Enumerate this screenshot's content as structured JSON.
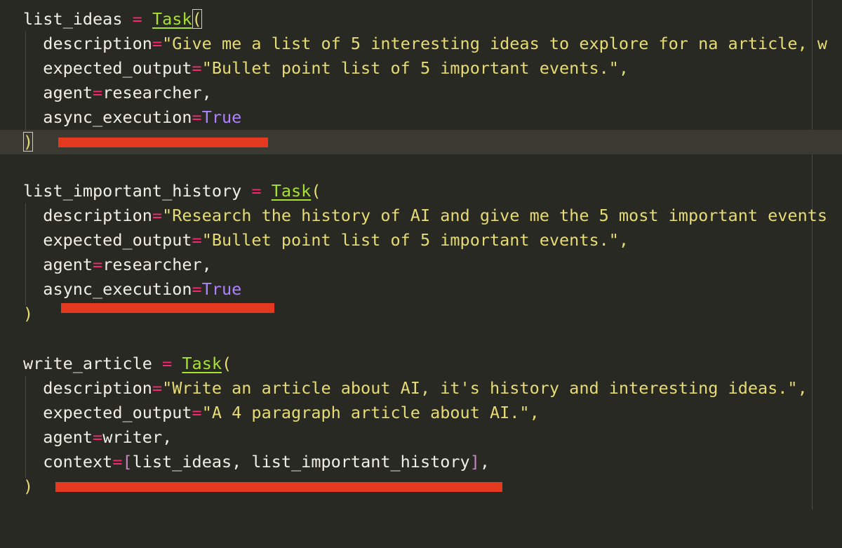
{
  "editor": {
    "blocks": [
      {
        "var": "list_ideas",
        "eq": "=",
        "cls": "Task",
        "open": "(",
        "desc_key": "description",
        "desc_val": "\"Give me a list of 5 interesting ideas to explore for na article, w",
        "exp_key": "expected_output",
        "exp_val": "\"Bullet point list of 5 important events.\",",
        "agent_key": "agent",
        "agent_val": "researcher,",
        "last_key": "async_execution",
        "last_val": "True",
        "close": ")"
      },
      {
        "var": "list_important_history",
        "eq": "=",
        "cls": "Task",
        "open": "(",
        "desc_key": "description",
        "desc_val": "\"Research the history of AI and give me the 5 most important events",
        "exp_key": "expected_output",
        "exp_val": "\"Bullet point list of 5 important events.\",",
        "agent_key": "agent",
        "agent_val": "researcher,",
        "last_key": "async_execution",
        "last_val": "True",
        "close": ")"
      },
      {
        "var": "write_article",
        "eq": "=",
        "cls": "Task",
        "open": "(",
        "desc_key": "description",
        "desc_val": "\"Write an article about AI, it's history and interesting ideas.\",",
        "exp_key": "expected_output",
        "exp_val": "\"A 4 paragraph article about AI.\",",
        "agent_key": "agent",
        "agent_val": "writer,",
        "last_key": "context",
        "ctx_open": "[",
        "ctx_val": "list_ideas, list_important_history",
        "ctx_close": "]",
        "ctx_tail": ",",
        "close": ")"
      }
    ],
    "colors": {
      "background": "#282923",
      "current_line": "#3b3a32",
      "operator": "#f92672",
      "class": "#a6e22e",
      "string": "#e6db74",
      "constant": "#ae81ff",
      "highlight_mark": "#e5391f"
    }
  }
}
